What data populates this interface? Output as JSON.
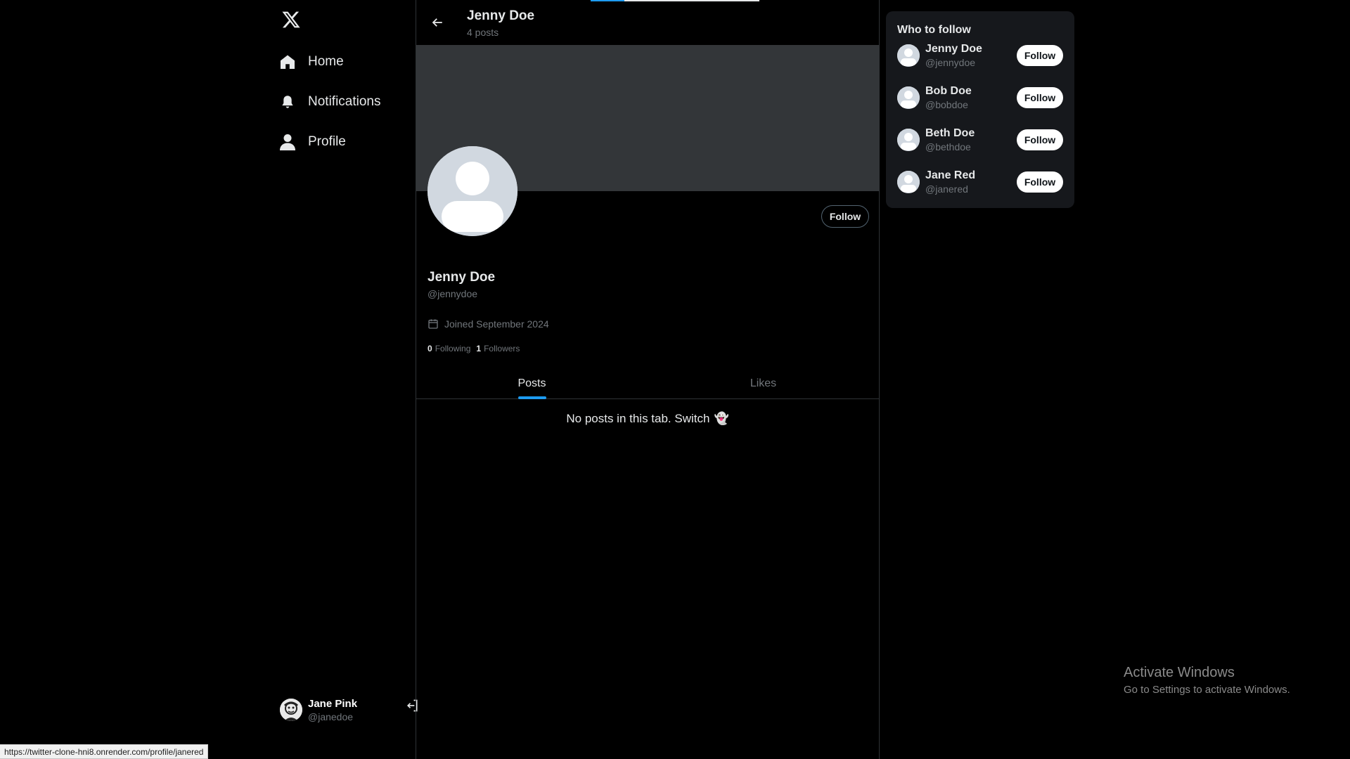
{
  "app": {
    "logo": "x-logo-icon"
  },
  "sidebar": {
    "items": [
      {
        "label": "Home",
        "icon": "home-icon"
      },
      {
        "label": "Notifications",
        "icon": "bell-icon"
      },
      {
        "label": "Profile",
        "icon": "user-icon"
      }
    ],
    "account": {
      "name": "Jane Pink",
      "handle": "@janedoe"
    }
  },
  "header": {
    "title": "Jenny Doe",
    "subtitle": "4 posts"
  },
  "profile": {
    "name": "Jenny Doe",
    "handle": "@jennydoe",
    "follow_label": "Follow",
    "joined": "Joined September 2024",
    "following_count": "0",
    "following_label": "Following",
    "followers_count": "1",
    "followers_label": "Followers"
  },
  "tabs": [
    {
      "label": "Posts",
      "active": true
    },
    {
      "label": "Likes",
      "active": false
    }
  ],
  "feed": {
    "empty_message": "No posts in this tab. Switch",
    "empty_emoji": "👻"
  },
  "who_to_follow": {
    "title": "Who to follow",
    "users": [
      {
        "name": "Jenny Doe",
        "handle": "@jennydoe",
        "button": "Follow"
      },
      {
        "name": "Bob Doe",
        "handle": "@bobdoe",
        "button": "Follow"
      },
      {
        "name": "Beth Doe",
        "handle": "@bethdoe",
        "button": "Follow"
      },
      {
        "name": "Jane Red",
        "handle": "@janered",
        "button": "Follow"
      }
    ]
  },
  "watermark": {
    "line1": "Activate Windows",
    "line2": "Go to Settings to activate Windows."
  },
  "statusbar": {
    "url": "https://twitter-clone-hni8.onrender.com/profile/janered"
  },
  "colors": {
    "accent": "#1d9bf0",
    "background": "#000000",
    "banner": "#333639",
    "card": "#16181c"
  }
}
